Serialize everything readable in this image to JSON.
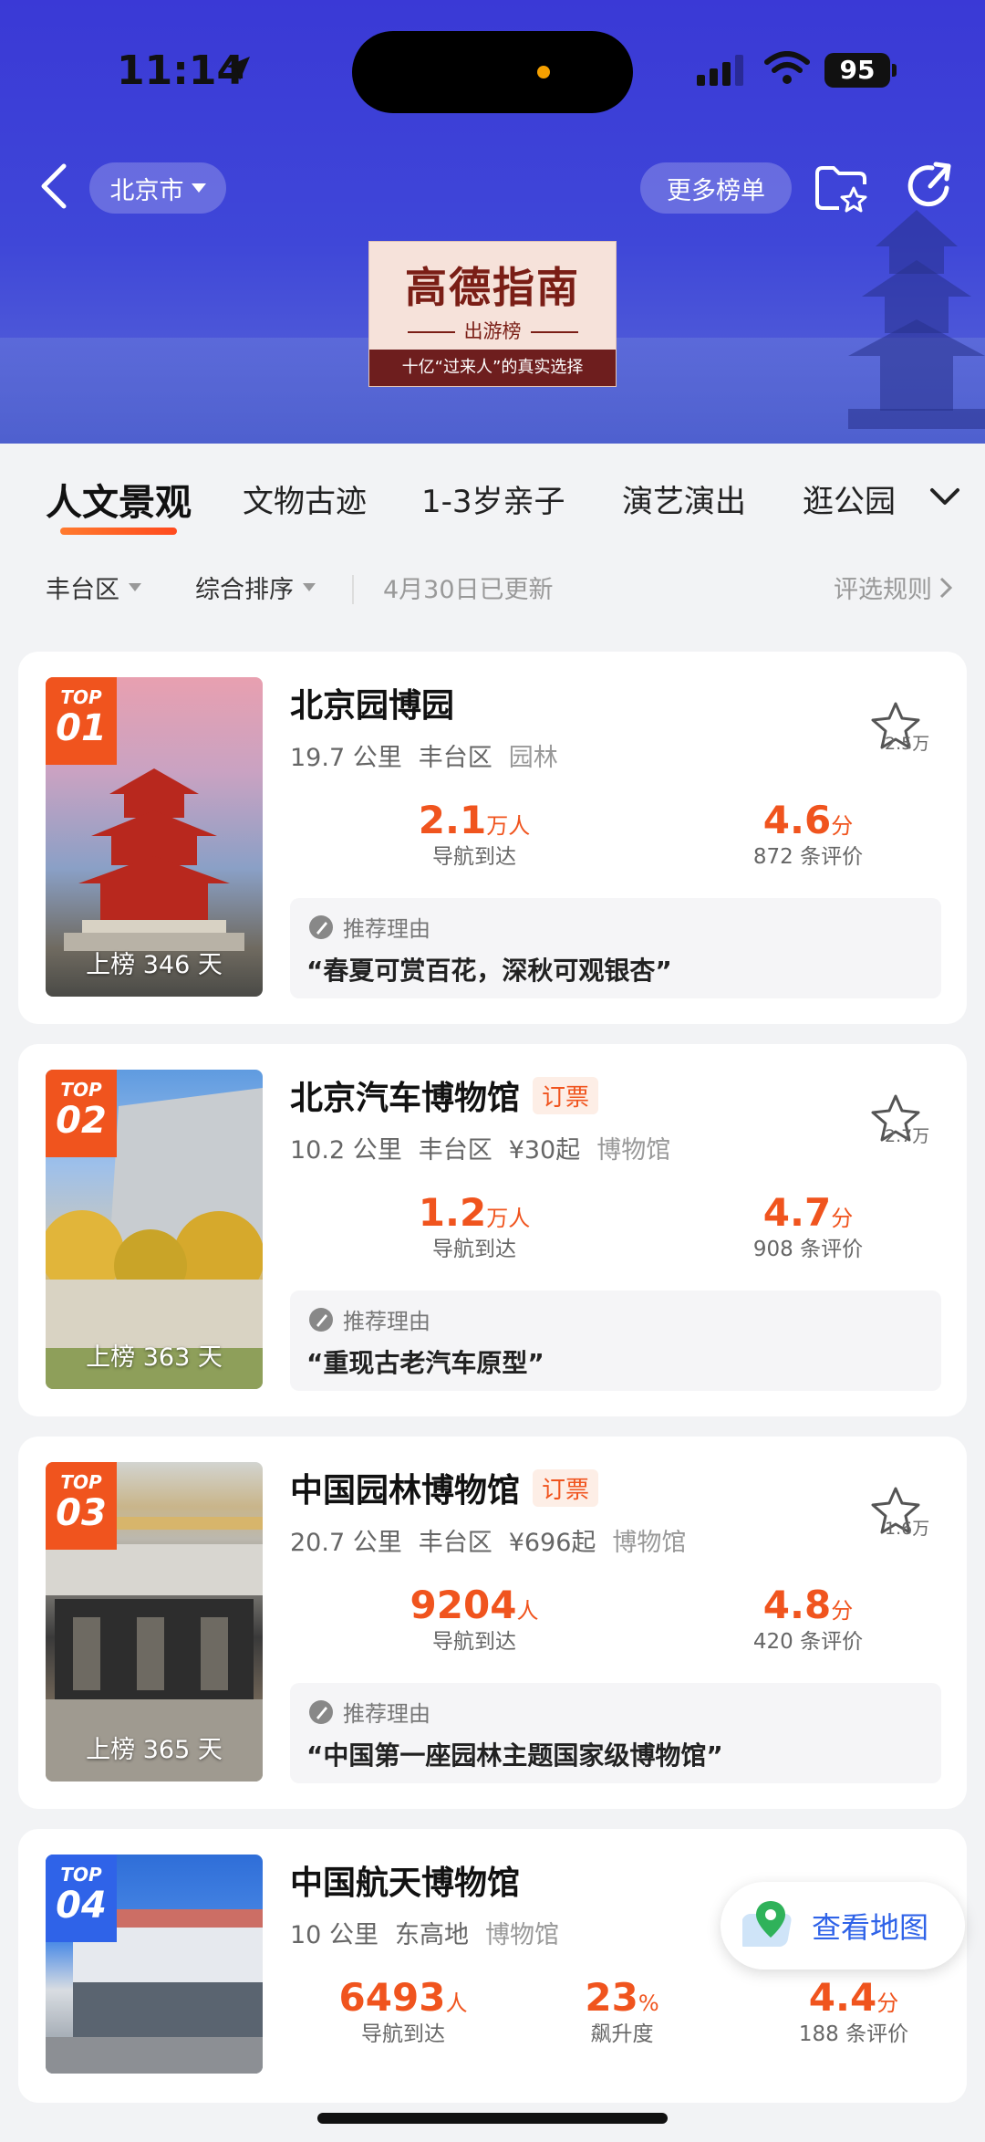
{
  "status_bar": {
    "time": "11:14",
    "battery": "95"
  },
  "header": {
    "city": "北京市",
    "more_lists": "更多榜单",
    "logo": {
      "title": "高德指南",
      "subtitle": "出游榜",
      "slogan": "十亿“过来人”的真实选择"
    }
  },
  "tabs": [
    "人文景观",
    "文物古迹",
    "1-3岁亲子",
    "演艺演出",
    "逛公园"
  ],
  "filters": {
    "district": "丰台区",
    "sort": "综合排序",
    "updated": "4月30日已更新",
    "rules": "评选规则"
  },
  "common": {
    "top_label": "TOP",
    "nav_label": "导航到达",
    "reason_label": "推荐理由",
    "rise_label": "飙升度"
  },
  "cards": [
    {
      "rank": "01",
      "name": "北京园博园",
      "ticket": "",
      "distance": "19.7 公里",
      "district": "丰台区",
      "price": "",
      "category": "园林",
      "fav": "2.5万",
      "nav_value": "2.1",
      "nav_unit": "万人",
      "score": "4.6",
      "score_unit": "分",
      "reviews": "872 条评价",
      "days": "上榜 346 天",
      "reason": "“春夏可赏百花，深秋可观银杏”"
    },
    {
      "rank": "02",
      "name": "北京汽车博物馆",
      "ticket": "订票",
      "distance": "10.2 公里",
      "district": "丰台区",
      "price": "¥30起",
      "category": "博物馆",
      "fav": "2.7万",
      "nav_value": "1.2",
      "nav_unit": "万人",
      "score": "4.7",
      "score_unit": "分",
      "reviews": "908 条评价",
      "days": "上榜 363 天",
      "reason": "“重现古老汽车原型”"
    },
    {
      "rank": "03",
      "name": "中国园林博物馆",
      "ticket": "订票",
      "distance": "20.7 公里",
      "district": "丰台区",
      "price": "¥696起",
      "category": "博物馆",
      "fav": "1.6万",
      "nav_value": "9204",
      "nav_unit": "人",
      "score": "4.8",
      "score_unit": "分",
      "reviews": "420 条评价",
      "days": "上榜 365 天",
      "reason": "“中国第一座园林主题国家级博物馆”"
    },
    {
      "rank": "04",
      "name": "中国航天博物馆",
      "distance": "10 公里",
      "district": "东高地",
      "category": "博物馆",
      "nav_value": "6493",
      "nav_unit": "人",
      "rise_value": "23",
      "rise_unit": "%",
      "score": "4.4",
      "score_unit": "分",
      "reviews": "188 条评价"
    }
  ],
  "map_button": "查看地图"
}
